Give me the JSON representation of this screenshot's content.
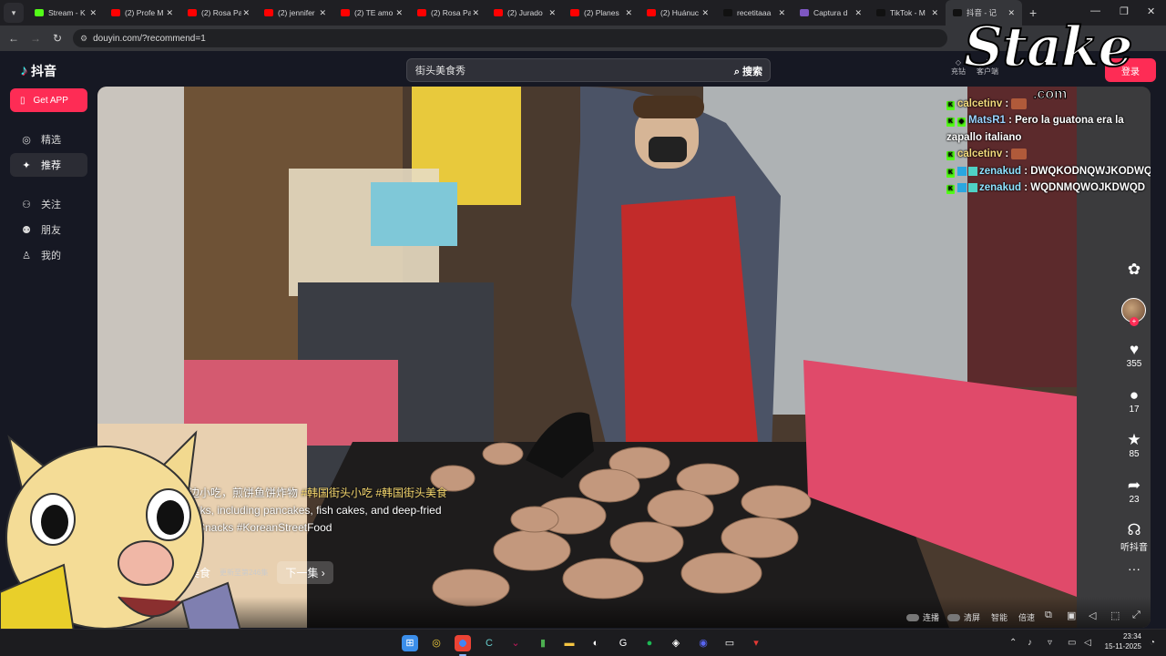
{
  "browser": {
    "tabs": [
      {
        "title": "Stream - K",
        "favicon_color": "#53fc18"
      },
      {
        "title": "(2) Profe M",
        "favicon_color": "#ff0000"
      },
      {
        "title": "(2) Rosa Pa",
        "favicon_color": "#ff0000"
      },
      {
        "title": "(2) jennifer",
        "favicon_color": "#ff0000"
      },
      {
        "title": "(2) TE amo",
        "favicon_color": "#ff0000"
      },
      {
        "title": "(2) Rosa Pa",
        "favicon_color": "#ff0000"
      },
      {
        "title": "(2) Jurado",
        "favicon_color": "#ff0000"
      },
      {
        "title": "(2) Planes",
        "favicon_color": "#ff0000"
      },
      {
        "title": "(2) Huánuc",
        "favicon_color": "#ff0000"
      },
      {
        "title": "recetitaaa",
        "favicon_color": "#111111"
      },
      {
        "title": "Captura d",
        "favicon_color": "#7e57c2"
      },
      {
        "title": "TikTok - M",
        "favicon_color": "#111111"
      },
      {
        "title": "抖音 - 记",
        "favicon_color": "#111111"
      }
    ],
    "url": "douyin.com/?recommend=1"
  },
  "douyin": {
    "logo_text": "抖音",
    "search_value": "街头美食秀",
    "search_button": "搜索",
    "get_app": "Get APP",
    "nav": [
      {
        "label": "精选",
        "icon": "compass-icon"
      },
      {
        "label": "推荐",
        "icon": "sparkle-icon"
      },
      {
        "label": "关注",
        "icon": "follow-icon"
      },
      {
        "label": "朋友",
        "icon": "friends-icon"
      },
      {
        "label": "我的",
        "icon": "profile-icon"
      }
    ],
    "top_right": {
      "item1": "充钻",
      "item2": "客户端",
      "login": "登录"
    }
  },
  "chat": [
    {
      "user": "calcetinv",
      "message": ""
    },
    {
      "user": "MatsR1",
      "message": "Pero la guatona era la zapallo italiano"
    },
    {
      "user": "calcetinv",
      "message": ""
    },
    {
      "user": "zenakud",
      "message": "DWQKODNQWJKODWQ"
    },
    {
      "user": "zenakud",
      "message": "WQDNMQWOJKDWQD"
    }
  ],
  "video": {
    "caption_line1_prefix": "边小吃，煎饼鱼饼炸物",
    "caption_line1_tags": "#韩国街头小吃 #韩国街头美食",
    "caption_line2": "acks, including pancakes, fish cakes, and deep-fried",
    "caption_line3": "etSnacks #KoreanStreetFood",
    "episode_title": "美食",
    "episode_update": "更新至第246集",
    "next_episode": "下一集",
    "controls": {
      "autoplay": "连播",
      "clear": "清屏",
      "smart": "智能",
      "speed": "倍速"
    }
  },
  "actions": {
    "likes": "355",
    "comments": "17",
    "favorites": "85",
    "shares": "23",
    "listen": "听抖音"
  },
  "overlay": {
    "brand": "Stake",
    "brand_suffix": ".com"
  },
  "taskbar": {
    "time": "23:34",
    "date": "15-11-2025"
  }
}
